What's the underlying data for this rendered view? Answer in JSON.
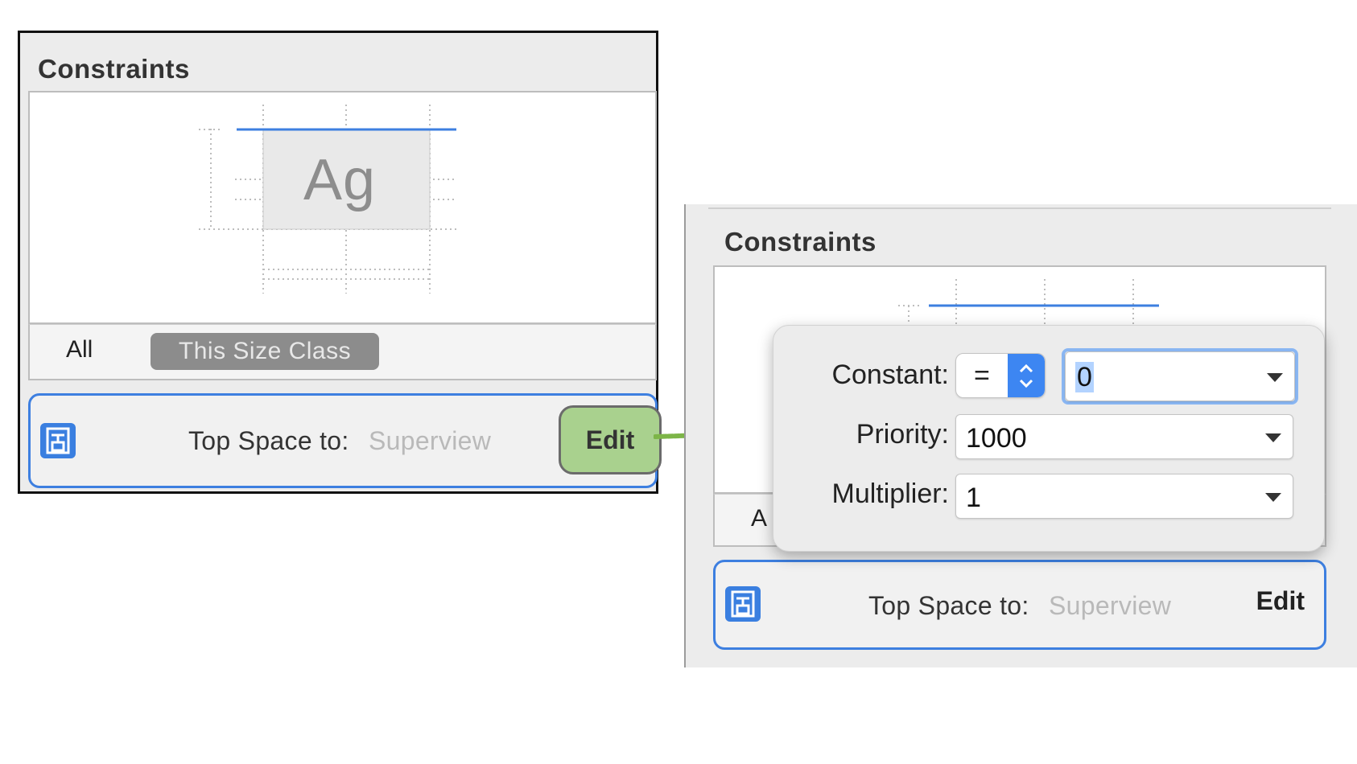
{
  "left_panel": {
    "title": "Constraints",
    "preview_glyph": "Ag",
    "tabs": {
      "all": "All",
      "size_class": "This Size Class"
    },
    "constraint_row": {
      "label": "Top Space to:",
      "value": "Superview",
      "edit_label": "Edit"
    }
  },
  "right_panel": {
    "title": "Constraints",
    "tab_partial": "A",
    "constraint_row": {
      "label": "Top Space to:",
      "value": "Superview",
      "edit_label": "Edit"
    },
    "popover": {
      "constant_label": "Constant:",
      "relation": "=",
      "constant_value": "0",
      "priority_label": "Priority:",
      "priority_value": "1000",
      "multiplier_label": "Multiplier:",
      "multiplier_value": "1"
    }
  },
  "colors": {
    "panel_bg": "#ececec",
    "accent_blue": "#3d7fe0",
    "highlight_green": "#a9d18e",
    "arrow_green": "#7db548",
    "muted_text": "#b9b9b9"
  },
  "icons": {
    "constraint_row_icon": "constraint-document-icon",
    "arrow": "right-arrow-icon",
    "stepper": "up-down-stepper-icon",
    "dropdown": "dropdown-caret-icon"
  }
}
